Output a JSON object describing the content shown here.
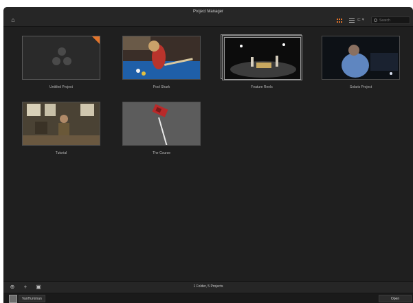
{
  "window": {
    "title": "Project Manager"
  },
  "toolbar": {
    "home_icon": "home-icon",
    "sort_label": "⊏ ▾",
    "search_placeholder": "Search"
  },
  "accent_color": "#e3742a",
  "projects": [
    {
      "name": "Untitled Project",
      "thumbnail": "resolve-logo",
      "current": true
    },
    {
      "name": "Pool Shark"
    },
    {
      "name": "Feature Reels",
      "is_folder": true
    },
    {
      "name": "Solaris Project"
    },
    {
      "name": "Tutorial"
    },
    {
      "name": "The Course"
    }
  ],
  "status": {
    "count_text": "1 Folder, 5 Projects"
  },
  "user": {
    "name": "VanHurkman"
  },
  "actions": {
    "open_label": "Open"
  }
}
